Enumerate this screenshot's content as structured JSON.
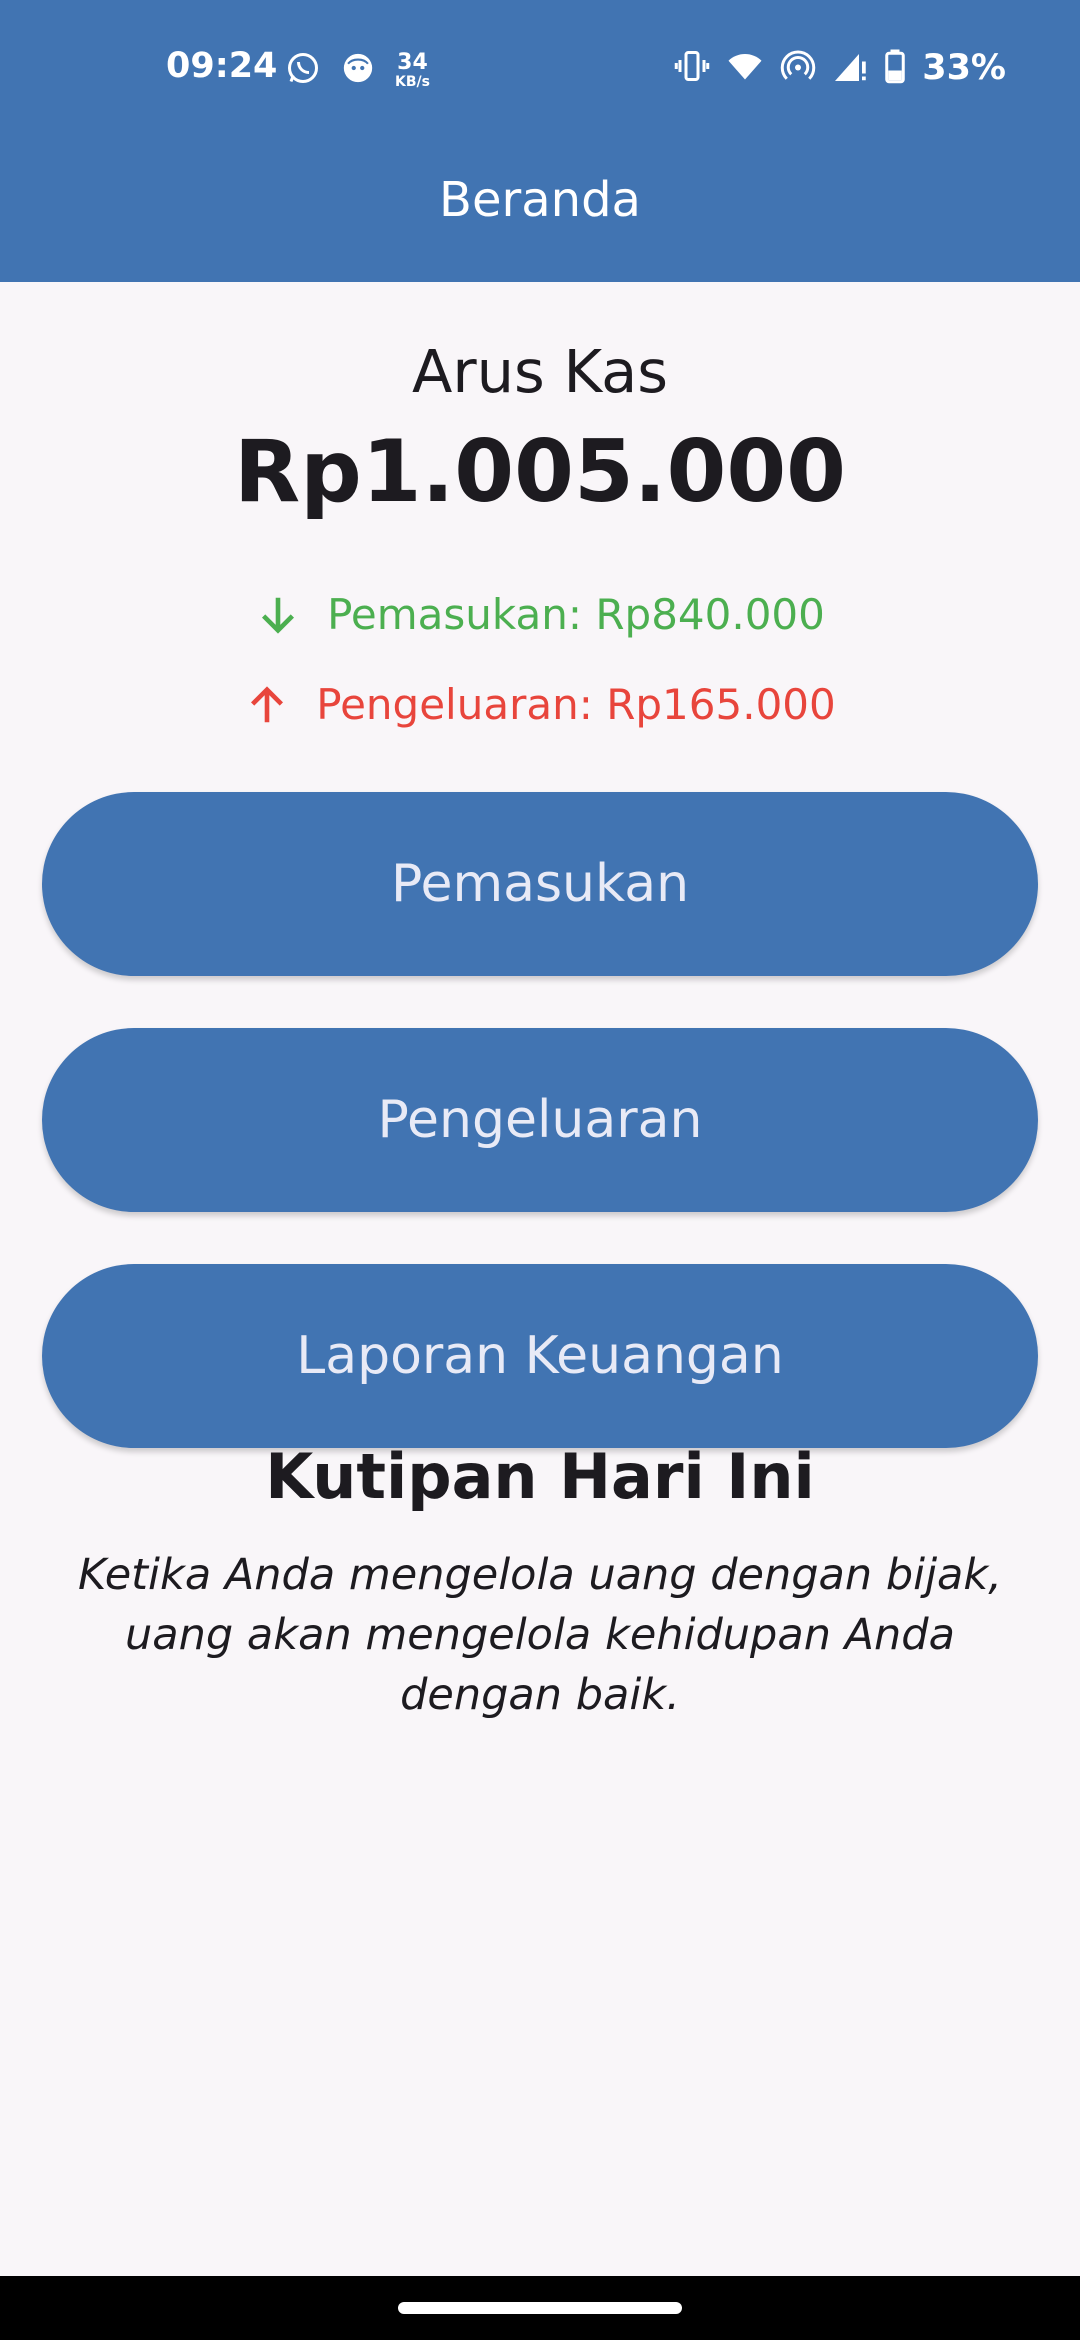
{
  "status_bar": {
    "time": "09:24",
    "speed_value": "34",
    "speed_unit": "KB/s",
    "battery": "33%",
    "icons": [
      "whatsapp-icon",
      "notification-face-icon",
      "vibrate-icon",
      "wifi-icon",
      "hotspot-icon",
      "signal-icon",
      "battery-icon"
    ]
  },
  "header": {
    "title": "Beranda"
  },
  "cash_flow": {
    "label": "Arus Kas",
    "value": "Rp1.005.000",
    "income_text": "Pemasukan: Rp840.000",
    "expense_text": "Pengeluaran: Rp165.000"
  },
  "buttons": {
    "income": "Pemasukan",
    "expense": "Pengeluaran",
    "report": "Laporan Keuangan"
  },
  "quote": {
    "title": "Kutipan Hari Ini",
    "text": "Ketika Anda mengelola uang dengan bijak, uang akan mengelola kehidupan Anda dengan baik."
  },
  "colors": {
    "primary": "#4174b2",
    "income": "#4caf50",
    "expense": "#e8453c",
    "background": "#f9f6f9"
  }
}
